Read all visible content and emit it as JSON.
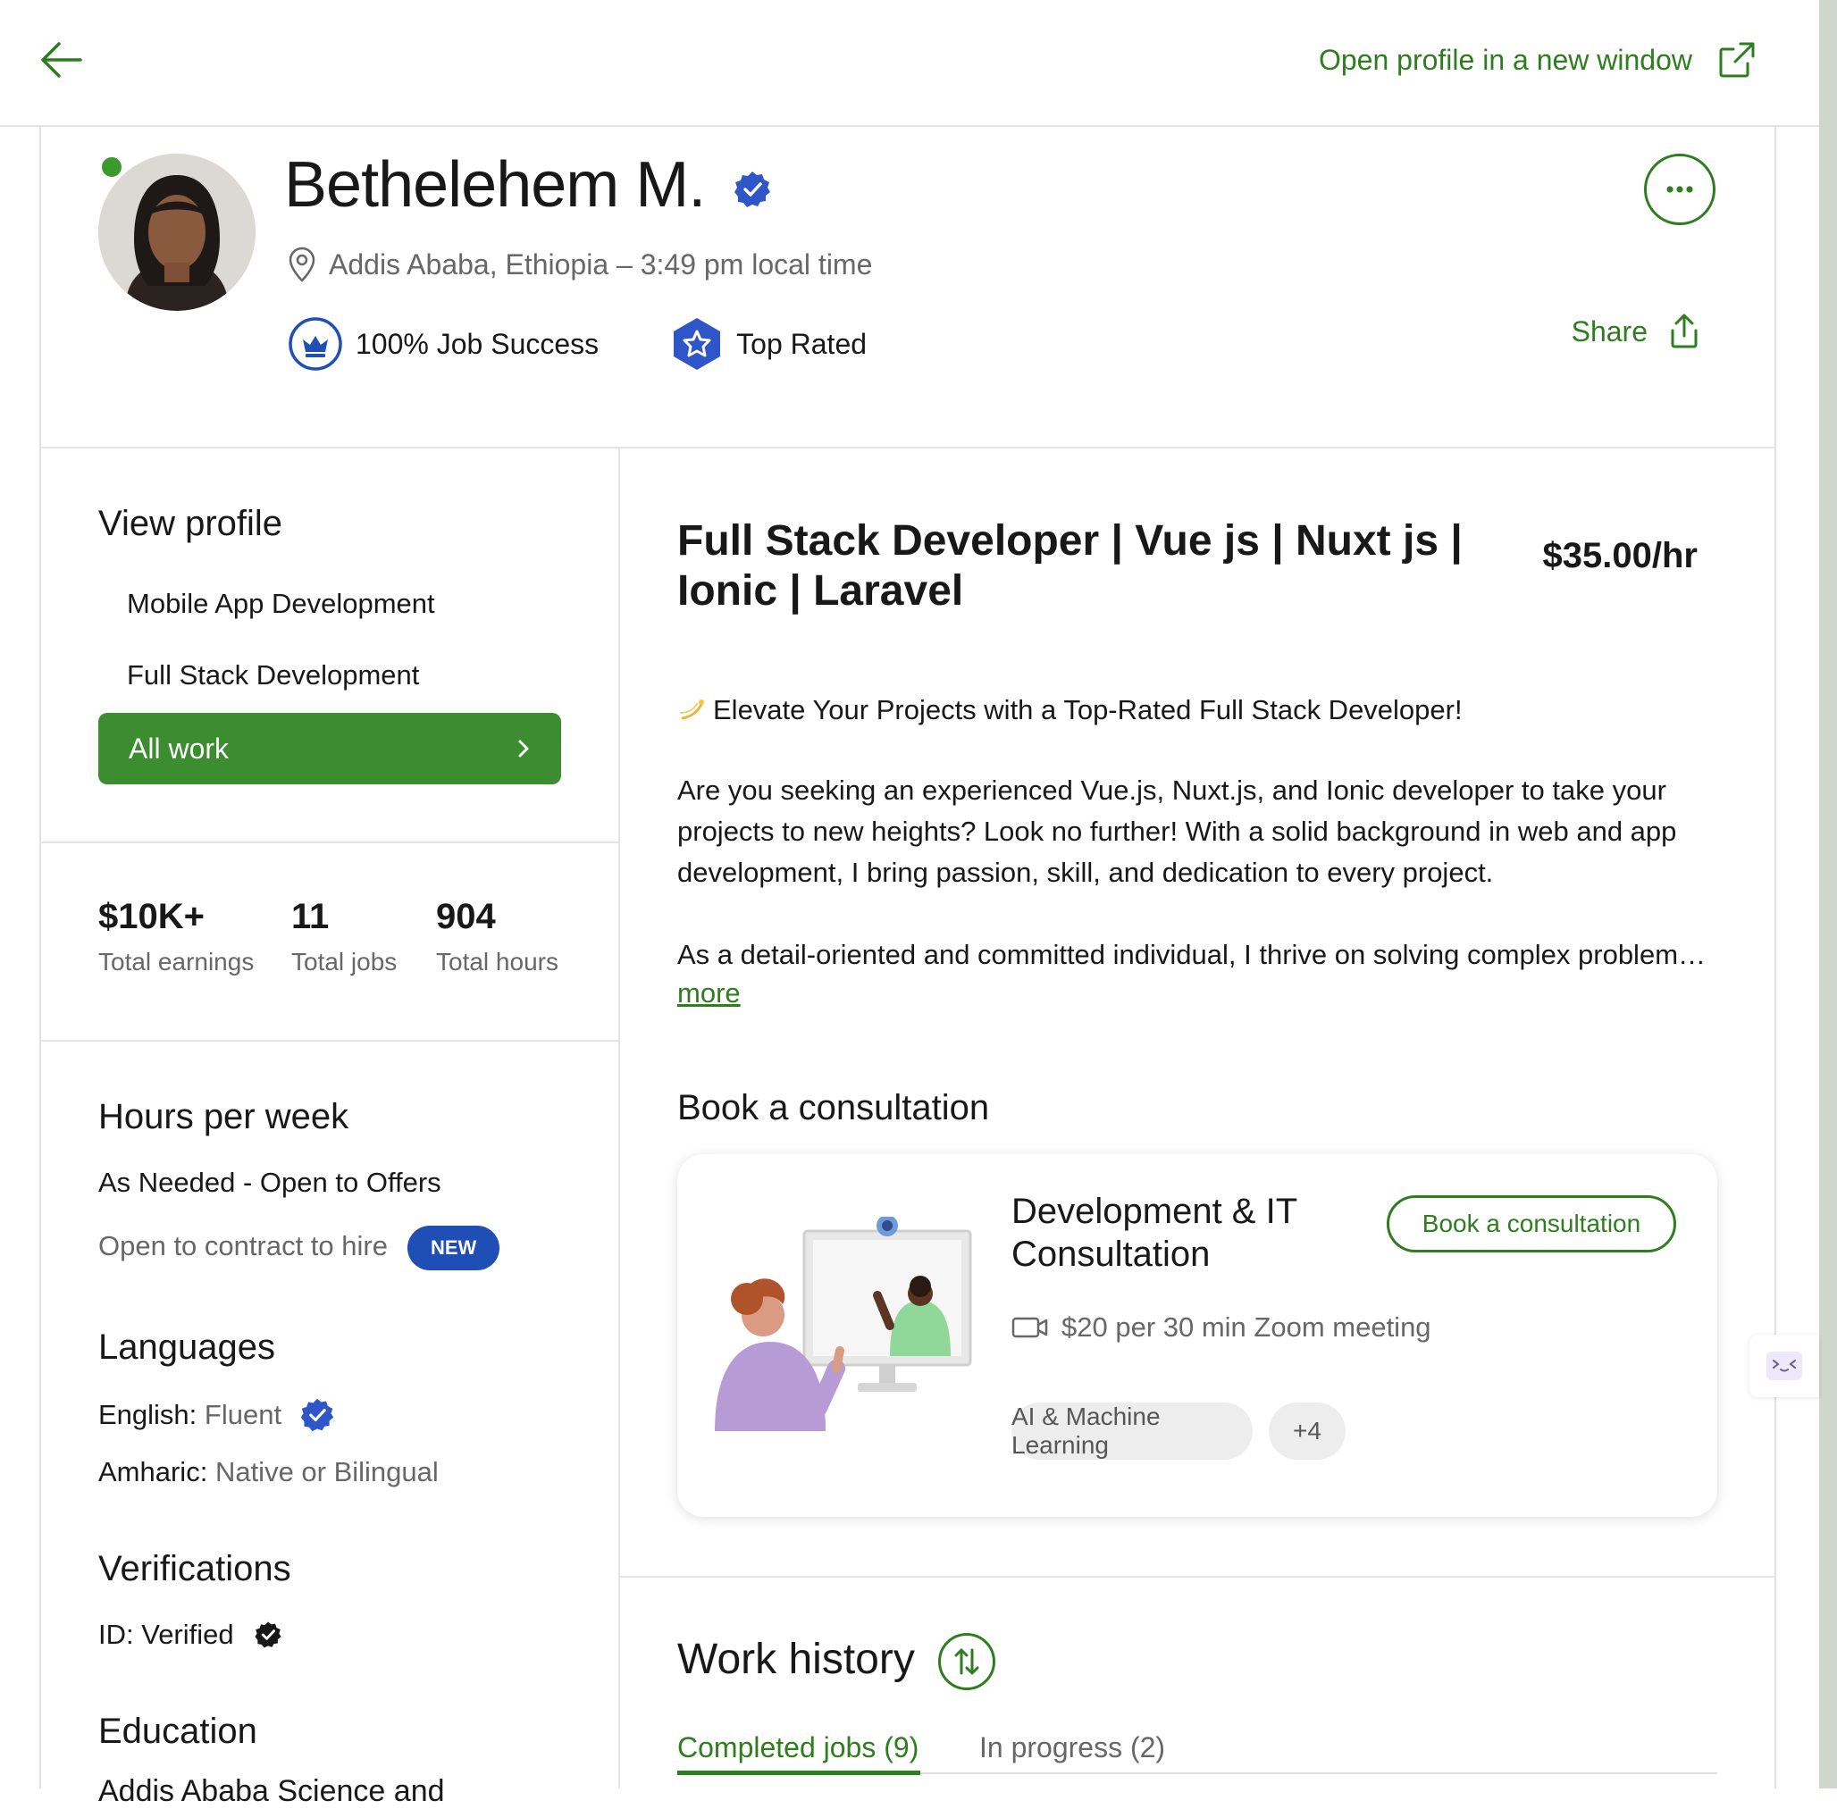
{
  "header": {
    "open_profile_label": "Open profile in a new window"
  },
  "profile": {
    "name": "Bethelehem M.",
    "location": "Addis Ababa, Ethiopia – 3:49 pm local time",
    "job_success": "100% Job Success",
    "top_rated": "Top Rated",
    "share_label": "Share"
  },
  "sidebar": {
    "view_profile_heading": "View profile",
    "items": [
      {
        "label": "Mobile App Development"
      },
      {
        "label": "Full Stack Development"
      }
    ],
    "all_work_label": "All work",
    "stats": [
      {
        "value": "$10K+",
        "label": "Total earnings"
      },
      {
        "value": "11",
        "label": "Total jobs"
      },
      {
        "value": "904",
        "label": "Total hours"
      }
    ],
    "hours_heading": "Hours per week",
    "hours_value": "As Needed - Open to Offers",
    "contract_to_hire": "Open to contract to hire",
    "new_badge": "NEW",
    "languages_heading": "Languages",
    "languages": [
      {
        "name": "English:",
        "level": "Fluent"
      },
      {
        "name": "Amharic:",
        "level": "Native or Bilingual"
      }
    ],
    "verifications_heading": "Verifications",
    "id_verified": "ID: Verified",
    "education_heading": "Education",
    "education_partial": "Addis Ababa Science and"
  },
  "main": {
    "title": "Full Stack Developer | Vue js | Nuxt js | Ionic | Laravel",
    "rate": "$35.00/hr",
    "overview_line1": "Elevate Your Projects with a Top-Rated Full Stack Developer!",
    "overview_para2": "Are you seeking an experienced Vue.js, Nuxt.js, and Ionic developer to take your projects to new heights? Look no further! With a solid background in web and app development, I bring passion, skill, and dedication to every project.",
    "overview_para3": "As a detail-oriented and committed individual, I thrive on solving complex problem…",
    "more_label": "more",
    "consultation_heading": "Book a consultation",
    "consultation": {
      "title": "Development & IT Consultation",
      "button_label": "Book a consultation",
      "price": "$20 per 30 min Zoom meeting",
      "tags": [
        "AI & Machine Learning",
        "+4"
      ]
    },
    "work_history_heading": "Work history",
    "tabs": [
      {
        "label": "Completed jobs (9)"
      },
      {
        "label": "In progress (2)"
      }
    ]
  },
  "colors": {
    "accent_green": "#2e7d1f",
    "button_green": "#3c8d2f",
    "badge_blue": "#1f4eb4"
  }
}
